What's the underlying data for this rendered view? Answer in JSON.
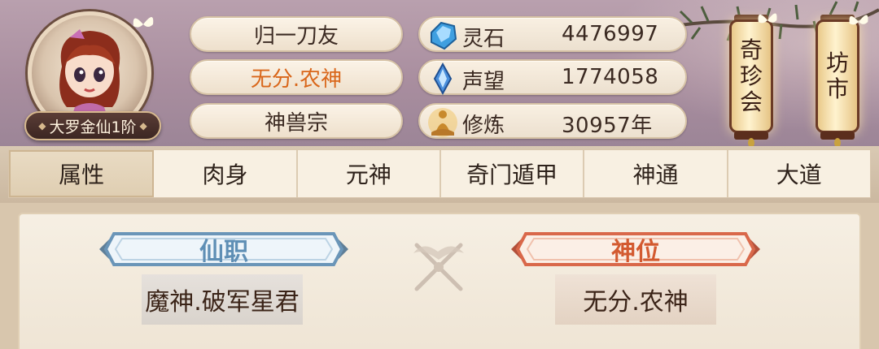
{
  "player": {
    "name": "归一刀友",
    "title": "无分.农神",
    "sect": "神兽宗",
    "rank": "大罗金仙1阶"
  },
  "stats": [
    {
      "icon": "spirit-stone-icon",
      "label": "灵石",
      "value": "4476997"
    },
    {
      "icon": "prestige-crystal-icon",
      "label": "声望",
      "value": "1774058"
    },
    {
      "icon": "meditation-icon",
      "label": "修炼",
      "value": "30957年"
    }
  ],
  "lanterns": [
    {
      "name": "treasure-pavilion",
      "label": [
        "奇",
        "珍",
        "会"
      ]
    },
    {
      "name": "market",
      "label": [
        "坊",
        "市"
      ]
    }
  ],
  "tabs": [
    "属性",
    "肉身",
    "元神",
    "奇门遁甲",
    "神通",
    "大道"
  ],
  "active_tab": 0,
  "positions": {
    "immortal_post": {
      "heading": "仙职",
      "value": "魔神.破军星君"
    },
    "divine_seat": {
      "heading": "神位",
      "value": "无分.农神"
    }
  },
  "colors": {
    "orange_title": "#d9661a",
    "blue_plate": "#6a95b8",
    "red_plate": "#d9684a"
  }
}
